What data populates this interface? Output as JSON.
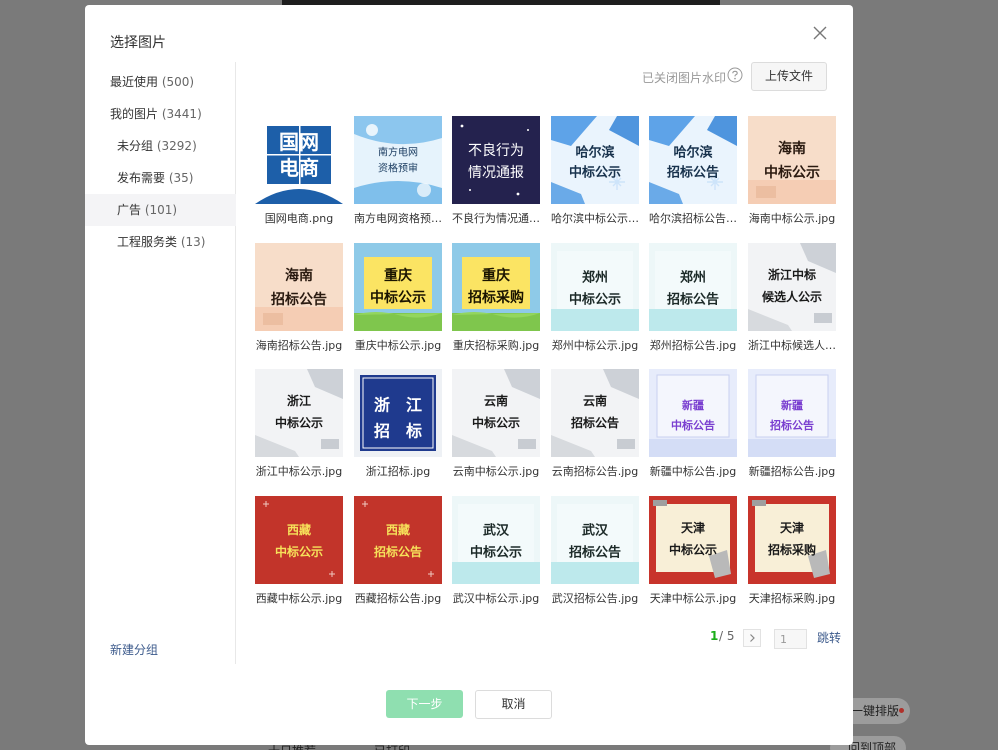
{
  "background": {
    "float_button_1": "一键排版",
    "float_button_2": "回到顶部",
    "strip_text_1": "十日推荐",
    "strip_text_2": "已打印"
  },
  "dialog": {
    "title": "选择图片",
    "watermark_status": "已关闭图片水印",
    "upload_label": "上传文件",
    "next_label": "下一步",
    "cancel_label": "取消",
    "accent_color": "#1aad19",
    "link_color": "#3d5b8c"
  },
  "sidebar": {
    "items": [
      {
        "label": "最近使用",
        "count": "(500)"
      },
      {
        "label": "我的图片",
        "count": "(3441)"
      },
      {
        "label": "未分组",
        "count": "(3292)"
      },
      {
        "label": "发布需要",
        "count": "(35)"
      },
      {
        "label": "广告",
        "count": "(101)",
        "active": true
      },
      {
        "label": "工程服务类",
        "count": "(13)"
      }
    ],
    "new_group_label": "新建分组"
  },
  "pagination": {
    "current": "1",
    "total": "/ 5",
    "input_value": "1",
    "jump_label": "跳转"
  },
  "images": [
    {
      "name": "国网电商.png",
      "theme": "brand",
      "lines": [
        "国网",
        "电商"
      ]
    },
    {
      "name": "南方电网资格预审.jpg",
      "theme": "sky",
      "lines": [
        "南方电网",
        "资格预审"
      ]
    },
    {
      "name": "不良行为情况通报.jpg",
      "theme": "navy",
      "lines": [
        "不良行为",
        "情况通报"
      ]
    },
    {
      "name": "哈尔滨中标公示.jpg",
      "theme": "winter",
      "lines": [
        "哈尔滨",
        "中标公示"
      ]
    },
    {
      "name": "哈尔滨招标公告.jpg",
      "theme": "winter",
      "lines": [
        "哈尔滨",
        "招标公告"
      ]
    },
    {
      "name": "海南中标公示.jpg",
      "theme": "peach",
      "lines": [
        "海南",
        "中标公示"
      ]
    },
    {
      "name": "海南招标公告.jpg",
      "theme": "peach",
      "lines": [
        "海南",
        "招标公告"
      ]
    },
    {
      "name": "重庆中标公示.jpg",
      "theme": "meadow",
      "lines": [
        "重庆",
        "中标公示"
      ]
    },
    {
      "name": "重庆招标采购.jpg",
      "theme": "meadow",
      "lines": [
        "重庆",
        "招标采购"
      ]
    },
    {
      "name": "郑州中标公示.jpg",
      "theme": "mint",
      "lines": [
        "郑州",
        "中标公示"
      ]
    },
    {
      "name": "郑州招标公告.jpg",
      "theme": "mint",
      "lines": [
        "郑州",
        "招标公告"
      ]
    },
    {
      "name": "浙江中标候选人公示.jpg",
      "theme": "grey",
      "lines": [
        "浙江中标",
        "候选人公示"
      ]
    },
    {
      "name": "浙江中标公示.jpg",
      "theme": "grey",
      "lines": [
        "浙江",
        "中标公示"
      ]
    },
    {
      "name": "浙江招标.jpg",
      "theme": "royal",
      "lines": [
        "浙　江",
        "招　标"
      ]
    },
    {
      "name": "云南中标公示.jpg",
      "theme": "grey",
      "lines": [
        "云南",
        "中标公示"
      ]
    },
    {
      "name": "云南招标公告.jpg",
      "theme": "grey",
      "lines": [
        "云南",
        "招标公告"
      ]
    },
    {
      "name": "新疆中标公告.jpg",
      "theme": "lavender",
      "lines": [
        "新疆",
        "中标公告"
      ]
    },
    {
      "name": "新疆招标公告.jpg",
      "theme": "lavender",
      "lines": [
        "新疆",
        "招标公告"
      ]
    },
    {
      "name": "西藏中标公示.jpg",
      "theme": "red",
      "lines": [
        "西藏",
        "中标公示"
      ]
    },
    {
      "name": "西藏招标公告.jpg",
      "theme": "red",
      "lines": [
        "西藏",
        "招标公告"
      ]
    },
    {
      "name": "武汉中标公示.jpg",
      "theme": "mint",
      "lines": [
        "武汉",
        "中标公示"
      ]
    },
    {
      "name": "武汉招标公告.jpg",
      "theme": "mint",
      "lines": [
        "武汉",
        "招标公告"
      ]
    },
    {
      "name": "天津中标公示.jpg",
      "theme": "scroll",
      "lines": [
        "天津",
        "中标公示"
      ]
    },
    {
      "name": "天津招标采购.jpg",
      "theme": "scroll",
      "lines": [
        "天津",
        "招标采购"
      ]
    }
  ]
}
